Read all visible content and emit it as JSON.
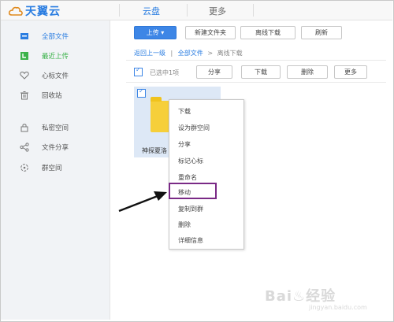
{
  "header": {
    "logo_text": "天翼云",
    "tabs": [
      {
        "label": "云盘",
        "active": true
      },
      {
        "label": "更多",
        "active": false
      }
    ],
    "accent": "#2a7de1"
  },
  "sidebar": {
    "items": [
      {
        "label": "全部文件",
        "icon": "folder-icon"
      },
      {
        "label": "最近上传",
        "icon": "recent-icon"
      },
      {
        "label": "心标文件",
        "icon": "heart-icon"
      },
      {
        "label": "回收站",
        "icon": "trash-icon"
      },
      {
        "label": "私密空间",
        "icon": "lock-icon"
      },
      {
        "label": "文件分享",
        "icon": "share-icon"
      },
      {
        "label": "群空间",
        "icon": "group-icon"
      }
    ]
  },
  "toolbar": {
    "upload_label": "上传 ▾",
    "new_folder_label": "新建文件夹",
    "offline_download_label": "离线下载",
    "refresh_label": "刷新"
  },
  "breadcrumb": {
    "back": "返回上一级",
    "sep1": "|",
    "all_files": "全部文件",
    "sep2": ">",
    "current": "离线下载"
  },
  "selection_bar": {
    "selected_text": "已选中1项",
    "share_label": "分享",
    "download_label": "下载",
    "delete_label": "删除",
    "more_label": "更多"
  },
  "file": {
    "name": "神探夏洛"
  },
  "context_menu": {
    "items": [
      "下载",
      "设为群空间",
      "分享",
      "标记心标",
      "重命名",
      "移动",
      "复制到群",
      "删除",
      "详细信息"
    ],
    "highlighted": "移动"
  },
  "watermark": {
    "text": "Bai♨经验",
    "sub": "jingyan.baidu.com"
  }
}
